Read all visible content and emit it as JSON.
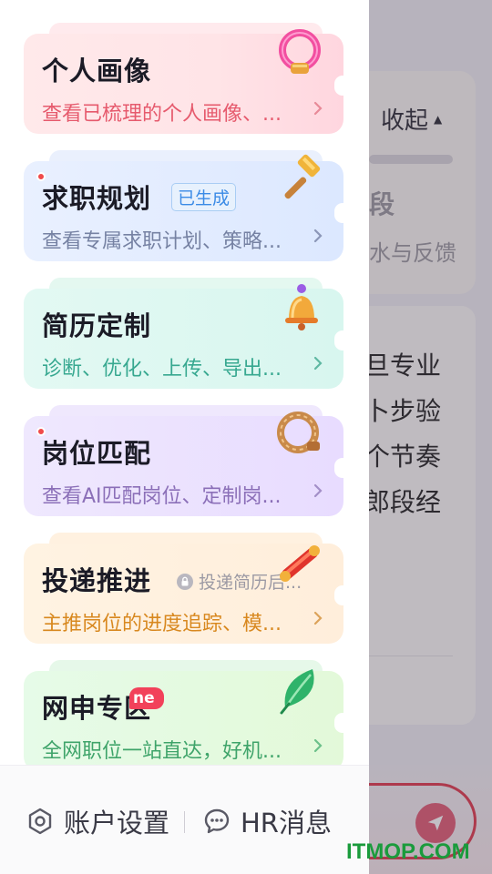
{
  "background": {
    "collapse_label": "收起",
    "stage_text": "段",
    "feedback_text": "水与反馈",
    "lines": [
      "旦专业",
      "卜步验",
      "个节奏",
      "郎段经"
    ]
  },
  "drawer": {
    "cards": [
      {
        "title": "个人画像",
        "desc": "查看已梳理的个人画像、...",
        "icon": "ring-icon"
      },
      {
        "title": "求职规划",
        "badge": "已生成",
        "desc": "查看专属求职计划、策略...",
        "icon": "hammer-icon",
        "red_dot": true
      },
      {
        "title": "简历定制",
        "desc": "诊断、优化、上传、导出...",
        "icon": "bell-icon"
      },
      {
        "title": "岗位匹配",
        "desc": "查看AI匹配岗位、定制岗...",
        "icon": "rope-ring-icon",
        "red_dot": true
      },
      {
        "title": "投递推进",
        "locked_text": "投递简历后...",
        "desc": "主推岗位的进度追踪、模...",
        "icon": "scroll-icon"
      },
      {
        "title": "网申专区",
        "new_badge": "ne",
        "desc": "全网职位一站直达，好机...",
        "icon": "leaf-icon"
      }
    ],
    "footer": {
      "settings_label": "账户设置",
      "hr_label": "HR消息"
    }
  },
  "watermark": "ITMOP.COM",
  "colors": {
    "accent_red": "#f04a4a",
    "badge_blue": "#3b8be6"
  }
}
